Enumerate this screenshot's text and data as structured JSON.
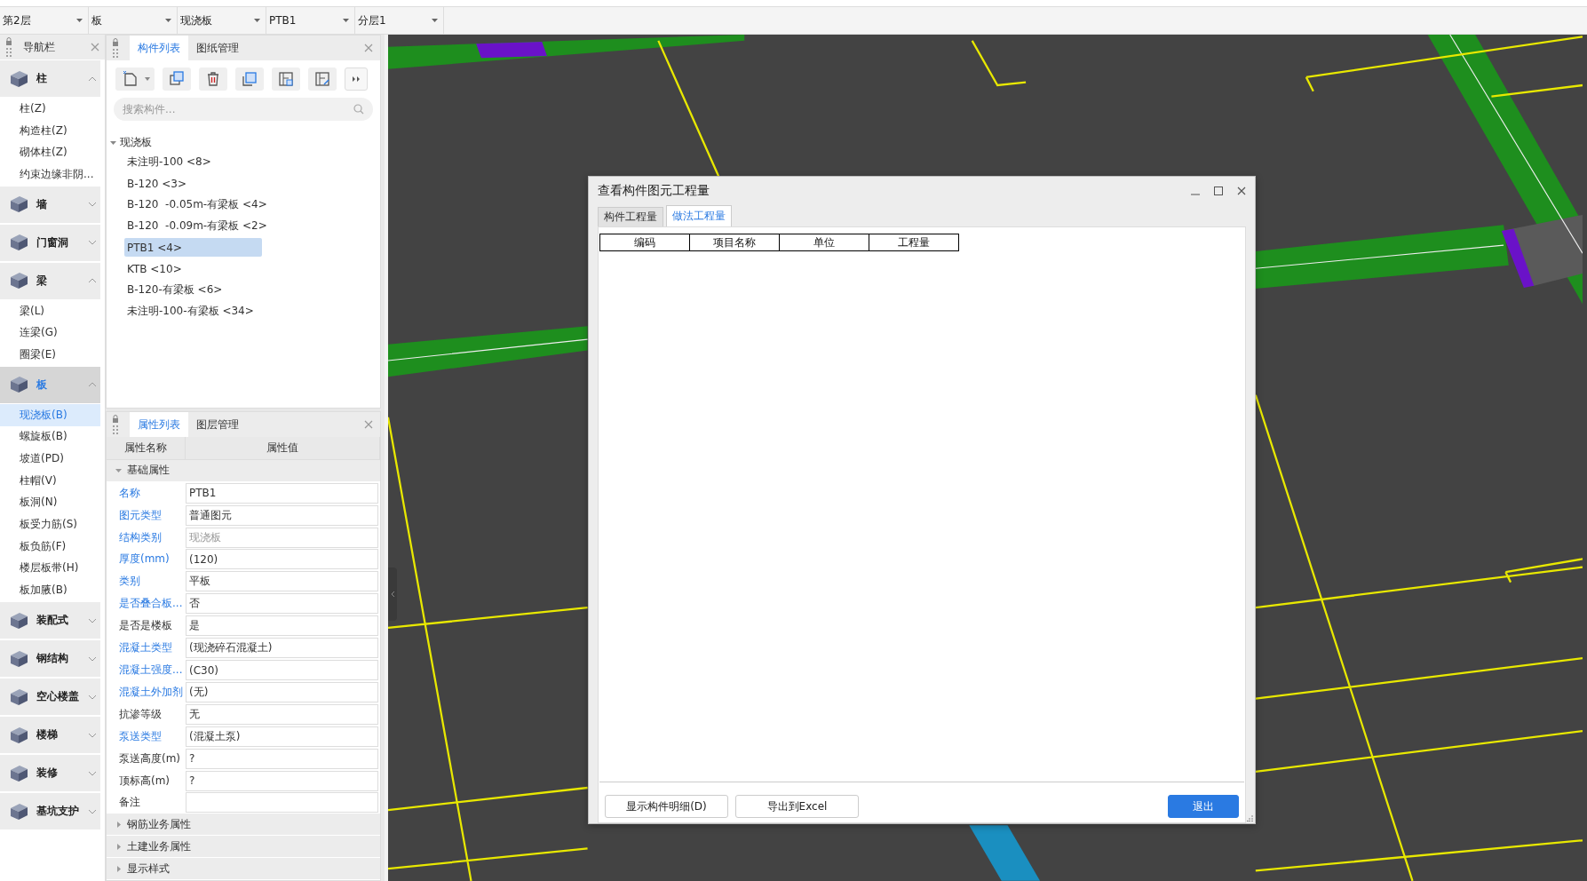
{
  "toolbar_dropdowns": [
    {
      "value": "第2层"
    },
    {
      "value": "板"
    },
    {
      "value": "现浇板"
    },
    {
      "value": "PTB1"
    },
    {
      "value": "分层1"
    }
  ],
  "nav": {
    "title": "导航栏",
    "categories": [
      {
        "label": "柱",
        "expanded": true,
        "selected": false,
        "items": [
          {
            "label": "柱(Z)",
            "selected": false
          },
          {
            "label": "构造柱(Z)",
            "selected": false
          },
          {
            "label": "砌体柱(Z)",
            "selected": false
          },
          {
            "label": "约束边缘非阴...",
            "selected": false
          }
        ]
      },
      {
        "label": "墙",
        "expanded": false,
        "selected": false
      },
      {
        "label": "门窗洞",
        "expanded": false,
        "selected": false
      },
      {
        "label": "梁",
        "expanded": true,
        "selected": false,
        "items": [
          {
            "label": "梁(L)",
            "selected": false
          },
          {
            "label": "连梁(G)",
            "selected": false
          },
          {
            "label": "圈梁(E)",
            "selected": false
          }
        ]
      },
      {
        "label": "板",
        "expanded": true,
        "selected": true,
        "items": [
          {
            "label": "现浇板(B)",
            "selected": true
          },
          {
            "label": "螺旋板(B)",
            "selected": false
          },
          {
            "label": "坡道(PD)",
            "selected": false
          },
          {
            "label": "柱帽(V)",
            "selected": false
          },
          {
            "label": "板洞(N)",
            "selected": false
          },
          {
            "label": "板受力筋(S)",
            "selected": false
          },
          {
            "label": "板负筋(F)",
            "selected": false
          },
          {
            "label": "楼层板带(H)",
            "selected": false
          },
          {
            "label": "板加腋(B)",
            "selected": false
          }
        ]
      },
      {
        "label": "装配式",
        "expanded": false,
        "selected": false
      },
      {
        "label": "钢结构",
        "expanded": false,
        "selected": false
      },
      {
        "label": "空心楼盖",
        "expanded": false,
        "selected": false
      },
      {
        "label": "楼梯",
        "expanded": false,
        "selected": false
      },
      {
        "label": "装修",
        "expanded": false,
        "selected": false
      },
      {
        "label": "基坑支护",
        "expanded": false,
        "selected": false
      }
    ]
  },
  "component_panel": {
    "tabs": [
      {
        "label": "构件列表",
        "selected": true
      },
      {
        "label": "图纸管理",
        "selected": false
      }
    ],
    "search": {
      "placeholder": "搜索构件..."
    },
    "tree": [
      {
        "label": "现浇板",
        "expanded": true,
        "children": [
          {
            "label": "未注明-100 <8>",
            "selected": false
          },
          {
            "label": "B-120 <3>",
            "selected": false
          },
          {
            "label": "B-120  -0.05m-有梁板 <4>",
            "selected": false
          },
          {
            "label": "B-120  -0.09m-有梁板 <2>",
            "selected": false
          },
          {
            "label": "PTB1 <4>",
            "selected": true
          },
          {
            "label": "KTB <10>",
            "selected": false
          },
          {
            "label": "B-120-有梁板 <6>",
            "selected": false
          },
          {
            "label": "未注明-100-有梁板 <34>",
            "selected": false
          }
        ]
      }
    ]
  },
  "property_panel": {
    "tabs": [
      {
        "label": "属性列表",
        "selected": true
      },
      {
        "label": "图层管理",
        "selected": false
      }
    ],
    "columns": [
      "属性名称",
      "属性值"
    ],
    "groups": [
      {
        "label": "基础属性",
        "expanded": true,
        "rows": [
          {
            "name": "名称",
            "value": "PTB1",
            "highlighted": true,
            "disabled": false
          },
          {
            "name": "图元类型",
            "value": "普通图元",
            "highlighted": true,
            "disabled": false
          },
          {
            "name": "结构类别",
            "value": "现浇板",
            "highlighted": true,
            "disabled": true
          },
          {
            "name": "厚度(mm)",
            "value": "(120)",
            "highlighted": true,
            "disabled": false
          },
          {
            "name": "类别",
            "value": "平板",
            "highlighted": true,
            "disabled": false
          },
          {
            "name": "是否叠合板...",
            "value": "否",
            "highlighted": true,
            "disabled": false
          },
          {
            "name": "是否是楼板",
            "value": "是",
            "highlighted": false,
            "disabled": false
          },
          {
            "name": "混凝土类型",
            "value": "(现浇碎石混凝土)",
            "highlighted": true,
            "disabled": false
          },
          {
            "name": "混凝土强度...",
            "value": "(C30)",
            "highlighted": true,
            "disabled": false
          },
          {
            "name": "混凝土外加剂",
            "value": "(无)",
            "highlighted": true,
            "disabled": false
          },
          {
            "name": "抗渗等级",
            "value": "无",
            "highlighted": false,
            "disabled": false
          },
          {
            "name": "泵送类型",
            "value": "(混凝土泵)",
            "highlighted": true,
            "disabled": false
          },
          {
            "name": "泵送高度(m)",
            "value": "?",
            "highlighted": false,
            "disabled": false
          },
          {
            "name": "顶标高(m)",
            "value": "?",
            "highlighted": false,
            "disabled": false
          },
          {
            "name": "备注",
            "highlighted": false,
            "disabled": false
          }
        ]
      },
      {
        "label": "钢筋业务属性",
        "expanded": false
      },
      {
        "label": "土建业务属性",
        "expanded": false
      },
      {
        "label": "显示样式",
        "expanded": false
      }
    ]
  },
  "dialog": {
    "title": "查看构件图元工程量",
    "tabs": [
      {
        "label": "构件工程量",
        "selected": false
      },
      {
        "label": "做法工程量",
        "selected": true
      }
    ],
    "table": {
      "columns": [
        "编码",
        "项目名称",
        "单位",
        "工程量"
      ]
    },
    "buttons": [
      {
        "label": "显示构件明细(D)",
        "primary": false
      },
      {
        "label": "导出到Excel",
        "primary": false
      },
      {
        "label": "退出",
        "primary": true
      }
    ]
  }
}
